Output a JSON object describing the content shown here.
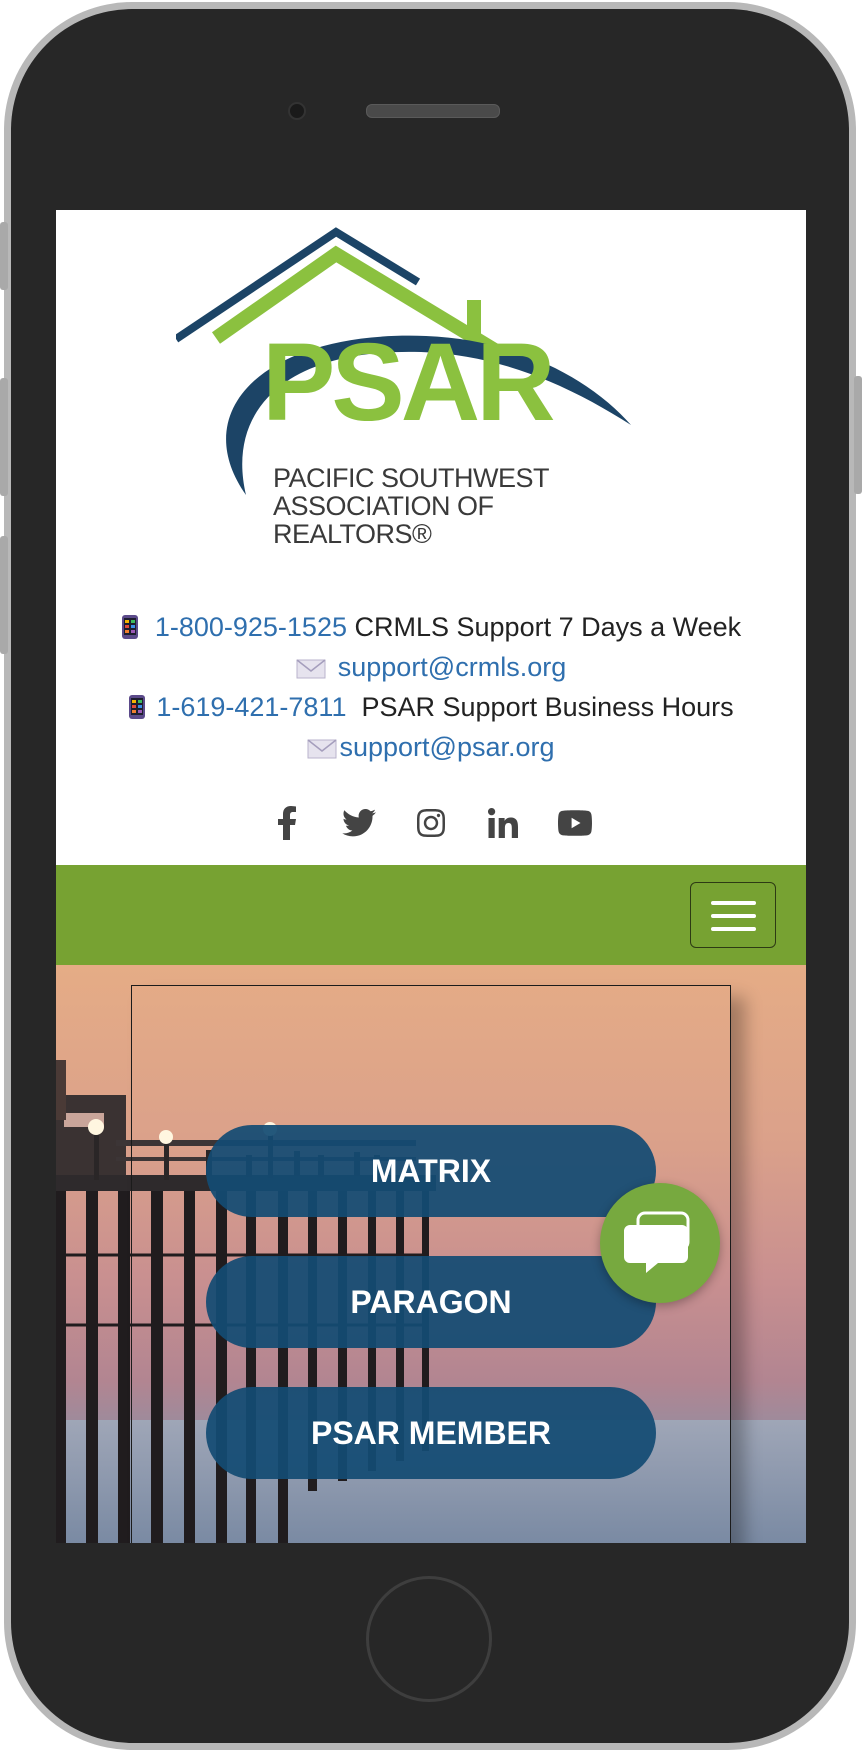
{
  "header": {
    "logo_name": "PSAR",
    "logo_line1": "PACIFIC SOUTHWEST",
    "logo_line2": "ASSOCIATION OF REALTORS®"
  },
  "contacts": {
    "crmls_phone": "1-800-925-1525",
    "crmls_text": "CRMLS Support 7 Days a Week",
    "crmls_email": "support@crmls.org",
    "psar_phone": "1-619-421-7811",
    "psar_text": "PSAR Support Business Hours",
    "psar_email": "support@psar.org"
  },
  "social": [
    "facebook-icon",
    "twitter-icon",
    "instagram-icon",
    "linkedin-icon",
    "youtube-icon"
  ],
  "hero": {
    "buttons": [
      "MATRIX",
      "PARAGON",
      "PSAR MEMBER"
    ]
  },
  "colors": {
    "brand_green": "#77a232",
    "brand_navy": "#134b73",
    "link_blue": "#2f6fae"
  }
}
